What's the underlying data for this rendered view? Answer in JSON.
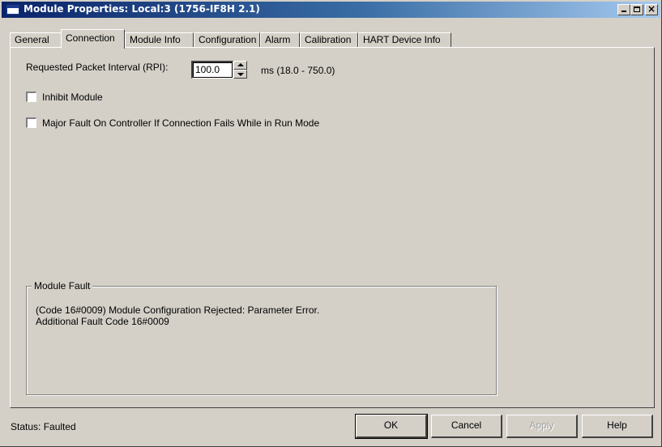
{
  "window": {
    "title": "Module Properties: Local:3 (1756-IF8H 2.1)",
    "minimize_glyph": "",
    "maximize_glyph": "",
    "close_glyph": "×"
  },
  "tabs": [
    {
      "label": "General",
      "active": false
    },
    {
      "label": "Connection",
      "active": true
    },
    {
      "label": "Module Info",
      "active": false
    },
    {
      "label": "Configuration",
      "active": false
    },
    {
      "label": "Alarm",
      "active": false
    },
    {
      "label": "Calibration",
      "active": false
    },
    {
      "label": "HART Device Info",
      "active": false
    }
  ],
  "connection": {
    "rpi_label": "Requested Packet Interval (RPI):",
    "rpi_value": "100.0",
    "rpi_range": "ms (18.0 - 750.0)",
    "inhibit_label": "Inhibit Module",
    "inhibit_checked": false,
    "major_fault_label": "Major Fault On Controller If Connection Fails While in Run Mode",
    "major_fault_checked": false
  },
  "module_fault": {
    "title": "Module Fault",
    "line1": "(Code 16#0009) Module Configuration Rejected: Parameter Error.",
    "line2": "Additional Fault Code 16#0009"
  },
  "footer": {
    "status_label": "Status:",
    "status_value": "Faulted",
    "ok_label": "OK",
    "cancel_label": "Cancel",
    "apply_label": "Apply",
    "apply_enabled": false,
    "help_label": "Help"
  }
}
